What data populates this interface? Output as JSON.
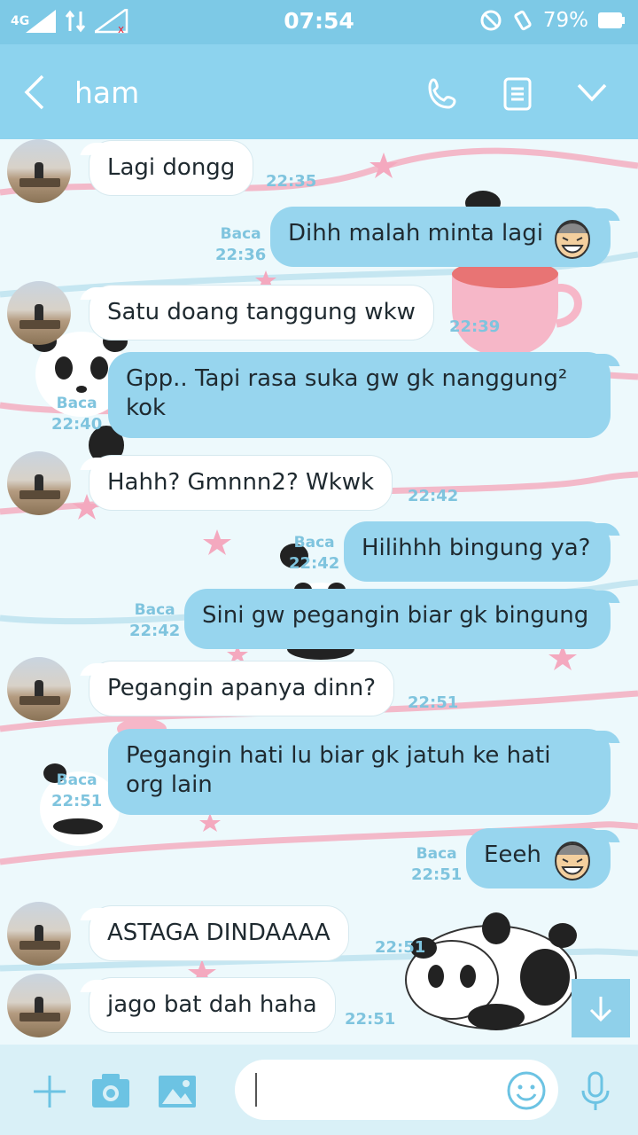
{
  "status_bar": {
    "network": "4G",
    "time": "07:54",
    "battery": "79%"
  },
  "header": {
    "title": "ham",
    "icons": [
      "back-arrow-icon",
      "phone-icon",
      "notes-icon",
      "chevron-down-icon"
    ]
  },
  "colors": {
    "status_bar": "#7dc9e6",
    "header": "#8dd3ee",
    "outgoing_bubble": "#97d5ee",
    "incoming_bubble": "#ffffff",
    "meta_text": "#7fc4de"
  },
  "messages": [
    {
      "dir": "in",
      "text": "Lagi dongg",
      "time": "22:35"
    },
    {
      "dir": "out",
      "text": "Dihh malah minta lagi",
      "time": "22:36",
      "read": "Baca",
      "emoji": "laughing-face"
    },
    {
      "dir": "in",
      "text": "Satu doang tanggung wkw",
      "time": "22:39"
    },
    {
      "dir": "out",
      "text": "Gpp.. Tapi rasa suka gw gk nanggung² kok",
      "time": "22:40",
      "read": "Baca"
    },
    {
      "dir": "in",
      "text": "Hahh? Gmnnn2? Wkwk",
      "time": "22:42"
    },
    {
      "dir": "out",
      "text": "Hilihhh bingung ya?",
      "time": "22:42",
      "read": "Baca"
    },
    {
      "dir": "out",
      "text": "Sini gw pegangin biar gk bingung",
      "time": "22:42",
      "read": "Baca"
    },
    {
      "dir": "in",
      "text": "Pegangin apanya dinn?",
      "time": "22:51"
    },
    {
      "dir": "out",
      "text": "Pegangin hati lu biar gk jatuh ke hati org lain",
      "time": "22:51",
      "read": "Baca"
    },
    {
      "dir": "out",
      "text": "Eeeh",
      "time": "22:51",
      "read": "Baca",
      "emoji": "laughing-face"
    },
    {
      "dir": "in",
      "text": "ASTAGA DINDAAAA",
      "time": "22:51"
    },
    {
      "dir": "in",
      "text": "jago bat dah haha",
      "time": "22:51"
    }
  ],
  "input_bar": {
    "icons": [
      "plus-icon",
      "camera-icon",
      "image-icon",
      "emoji-icon",
      "microphone-icon"
    ],
    "text": ""
  }
}
